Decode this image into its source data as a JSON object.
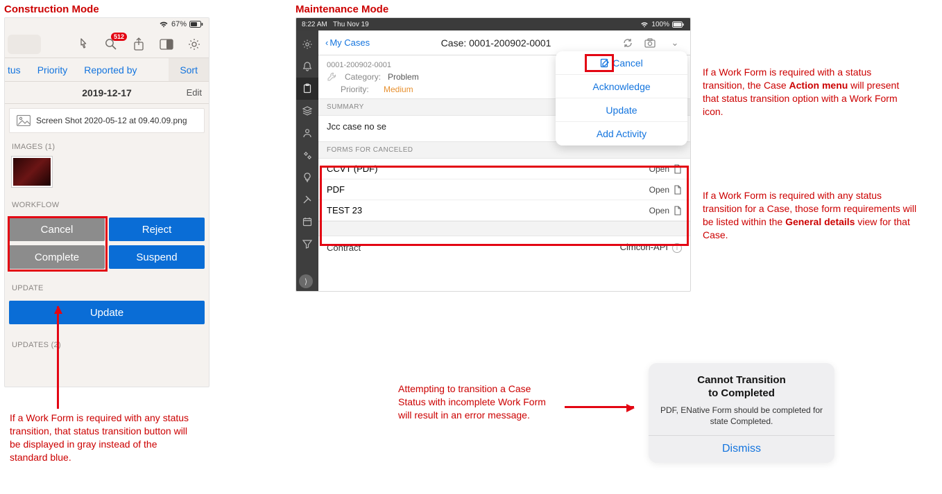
{
  "headings": {
    "construction": "Construction Mode",
    "maintenance": "Maintenance Mode"
  },
  "annotations": {
    "action_menu": {
      "pre": "If a Work Form is required with a status transition, the Case ",
      "bold": "Action menu",
      "post": " will present that status transition option with a Work Form icon."
    },
    "general_details": {
      "pre": "If a Work Form is required with any status transition for a Case, those form requirements will be listed within the ",
      "bold": "General details",
      "post": " view for that Case."
    },
    "gray_button": "If a Work Form is required with any status transition, that status transition button will be displayed in gray instead of the standard blue.",
    "error_msg": "Attempting to transition a Case Status with incomplete Work Form will result in an error message."
  },
  "construction": {
    "battery": "67%",
    "toolbar_badge": "512",
    "filter": {
      "tus": "tus",
      "priority": "Priority",
      "reported_by": "Reported by",
      "sort": "Sort"
    },
    "date": "2019-12-17",
    "edit": "Edit",
    "attachment": "Screen Shot 2020-05-12 at 09.40.09.png",
    "images_section": "IMAGES (1)",
    "workflow_section": "WORKFLOW",
    "buttons": {
      "cancel": "Cancel",
      "reject": "Reject",
      "complete": "Complete",
      "suspend": "Suspend"
    },
    "update_section": "UPDATE",
    "update_button": "Update",
    "updates_section": "UPDATES (2)"
  },
  "maintenance": {
    "status_time": "8:22 AM",
    "status_date": "Thu Nov 19",
    "status_batt": "100%",
    "back": "My Cases",
    "title": "Case: 0001-200902-0001",
    "case_id": "0001-200902-0001",
    "category_k": "Category:",
    "category_v": "Problem",
    "priority_k": "Priority:",
    "priority_v": "Medium",
    "summary_head": "SUMMARY",
    "summary_body": "Jcc case no se",
    "forms_head": "FORMS FOR CANCELED",
    "forms": [
      {
        "name": "CCVT (PDF)",
        "action": "Open"
      },
      {
        "name": "PDF",
        "action": "Open"
      },
      {
        "name": "TEST 23",
        "action": "Open"
      }
    ],
    "contract_k": "Contract",
    "contract_v": "Cimcon-API",
    "popover": {
      "cancel": "Cancel",
      "acknowledge": "Acknowledge",
      "update": "Update",
      "add_activity": "Add Activity"
    }
  },
  "alert": {
    "title_l1": "Cannot Transition",
    "title_l2": "to Completed",
    "message": "PDF, ENative Form should be completed for state Completed.",
    "dismiss": "Dismiss"
  }
}
